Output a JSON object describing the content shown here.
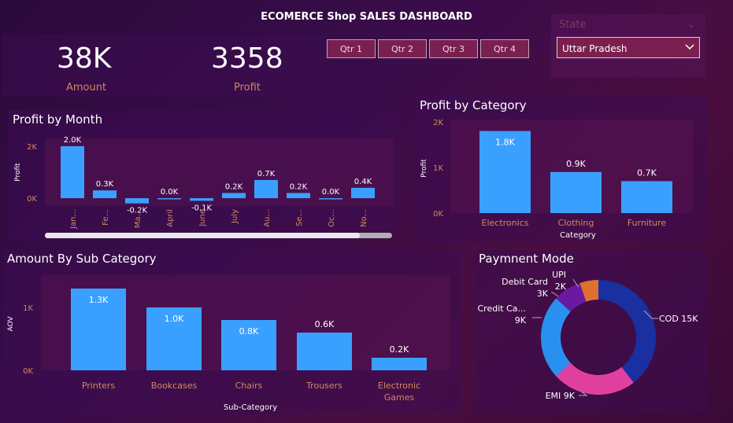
{
  "header": {
    "title": "ECOMERCE Shop SALES DASHBOARD"
  },
  "kpis": [
    {
      "value": "38K",
      "label": "Amount"
    },
    {
      "value": "3358",
      "label": "Profit"
    }
  ],
  "quarters": [
    "Qtr 1",
    "Qtr 2",
    "Qtr 3",
    "Qtr 4"
  ],
  "state_filter": {
    "label": "State",
    "selected": "Uttar Pradesh"
  },
  "colors": {
    "bar": "#3aa0ff",
    "axis_text": "#d28a5a",
    "label_text": "#ffffff"
  },
  "chart_data": [
    {
      "id": "profit_by_month",
      "type": "bar",
      "title": "Profit by Month",
      "ylabel": "Profit",
      "xlabel": "",
      "categories": [
        "Jan...",
        "Fe...",
        "Ma...",
        "April",
        "June",
        "July",
        "Au...",
        "Se...",
        "Oc...",
        "No..."
      ],
      "values": [
        2.0,
        0.3,
        -0.2,
        0.0,
        -0.1,
        0.2,
        0.7,
        0.2,
        0.0,
        0.4
      ],
      "value_labels": [
        "2.0K",
        "0.3K",
        "-0.2K",
        "0.0K",
        "-0.1K",
        "0.2K",
        "0.7K",
        "0.2K",
        "0.0K",
        "0.4K"
      ],
      "yticks": [
        "2K",
        "0K"
      ],
      "ylim": [
        -0.3,
        2.3
      ]
    },
    {
      "id": "profit_by_category",
      "type": "bar",
      "title": "Profit by Category",
      "ylabel": "Profit",
      "xlabel": "Category",
      "categories": [
        "Electronics",
        "Clothing",
        "Furniture"
      ],
      "values": [
        1.8,
        0.9,
        0.7
      ],
      "value_labels": [
        "1.8K",
        "0.9K",
        "0.7K"
      ],
      "yticks": [
        "2K",
        "1K",
        "0K"
      ],
      "ylim": [
        0,
        2
      ]
    },
    {
      "id": "amount_by_subcategory",
      "type": "bar",
      "title": "Amount By Sub Category",
      "ylabel": "AOV",
      "xlabel": "Sub-Category",
      "categories": [
        "Printers",
        "Bookcases",
        "Chairs",
        "Trousers",
        "Electronic Games"
      ],
      "values": [
        1.3,
        1.0,
        0.8,
        0.6,
        0.2
      ],
      "value_labels": [
        "1.3K",
        "1.0K",
        "0.8K",
        "0.6K",
        "0.2K"
      ],
      "yticks": [
        "1K",
        "0K"
      ],
      "ylim": [
        0,
        1.4
      ]
    },
    {
      "id": "payment_mode",
      "type": "pie",
      "title": "Paymnent Mode",
      "slices": [
        {
          "name": "COD",
          "value": 15,
          "label": "COD 15K",
          "color": "#1a2fa0"
        },
        {
          "name": "EMI",
          "value": 9,
          "label": "EMI 9K",
          "color": "#e040a0"
        },
        {
          "name": "Credit Ca...",
          "value": 9,
          "label": "9K",
          "color": "#2a90f0"
        },
        {
          "name": "Debit Card",
          "value": 3,
          "label": "3K",
          "color": "#6a1aa0"
        },
        {
          "name": "UPI",
          "value": 2,
          "label": "2K",
          "color": "#e07030"
        }
      ]
    }
  ]
}
